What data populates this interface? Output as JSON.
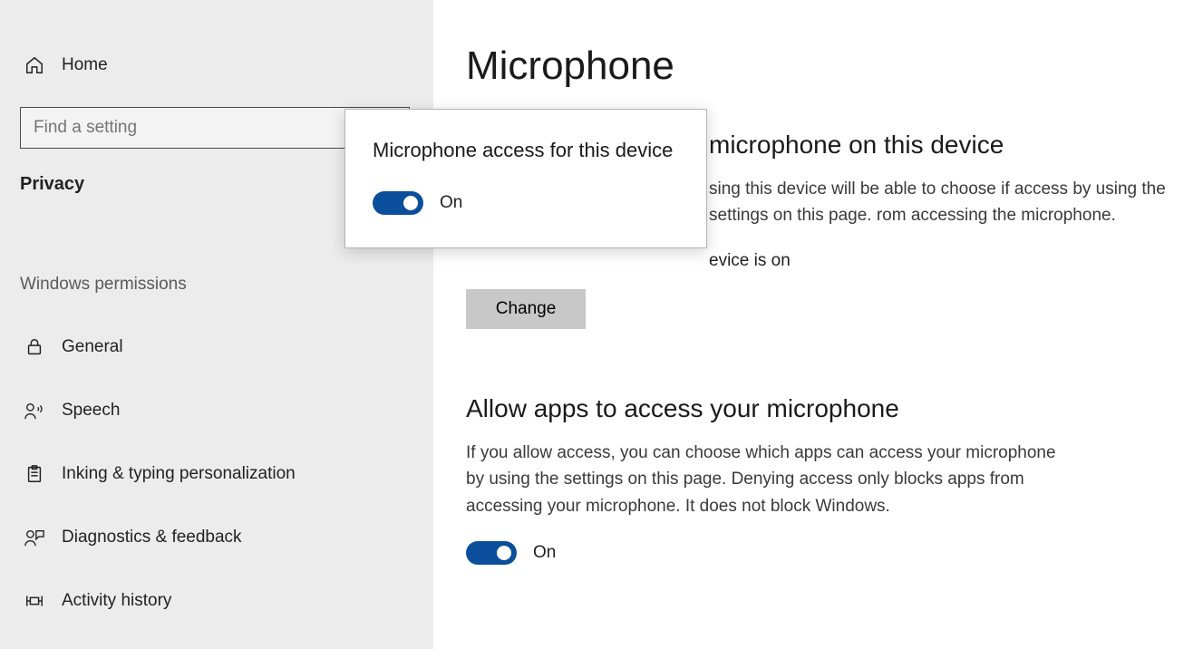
{
  "sidebar": {
    "home_label": "Home",
    "search_placeholder": "Find a setting",
    "category_label": "Privacy",
    "section_label": "Windows permissions",
    "items": [
      {
        "label": "General"
      },
      {
        "label": "Speech"
      },
      {
        "label": "Inking & typing personalization"
      },
      {
        "label": "Diagnostics & feedback"
      },
      {
        "label": "Activity history"
      }
    ]
  },
  "main": {
    "title": "Microphone",
    "section1": {
      "heading_fragment": "microphone on this device",
      "body_fragment": "sing this device will be able to choose if access by using the settings on this page. rom accessing the microphone.",
      "status_fragment": "evice is on",
      "change_label": "Change"
    },
    "section2": {
      "heading": "Allow apps to access your microphone",
      "body": "If you allow access, you can choose which apps can access your microphone by using the settings on this page. Denying access only blocks apps from accessing your microphone. It does not block Windows.",
      "toggle_label": "On"
    }
  },
  "popup": {
    "title": "Microphone access for this device",
    "toggle_label": "On",
    "toggle_on": true
  }
}
